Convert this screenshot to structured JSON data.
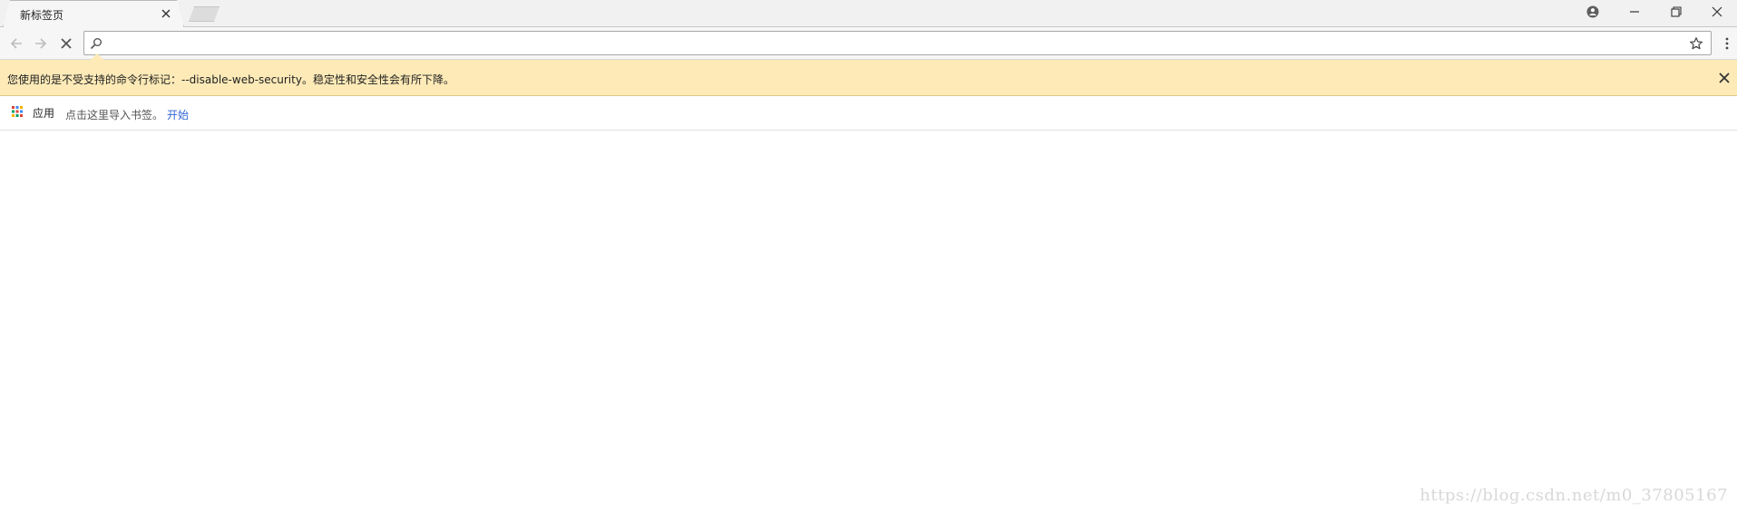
{
  "tabs": [
    {
      "title": "新标签页"
    }
  ],
  "infobar": {
    "message": "您使用的是不受支持的命令行标记：--disable-web-security。稳定性和安全性会有所下降。"
  },
  "omnibox": {
    "value": "",
    "placeholder": ""
  },
  "bookmarks": {
    "apps_label": "应用",
    "import_text": "点击这里导入书签。",
    "start_link": "开始"
  },
  "watermark": "https://blog.csdn.net/m0_37805167",
  "icons": [
    "close-icon",
    "profile-icon",
    "minimize-icon",
    "restore-icon",
    "window-close-icon",
    "back-arrow-icon",
    "forward-arrow-icon",
    "stop-icon",
    "search-icon",
    "star-icon",
    "kebab-menu-icon",
    "apps-grid-icon"
  ],
  "colors": {
    "infobar_bg": "#fdeab7",
    "link": "#3367d6",
    "apps_dots": [
      "#db4437",
      "#4285f4",
      "#f4b400",
      "#0f9d58"
    ]
  }
}
